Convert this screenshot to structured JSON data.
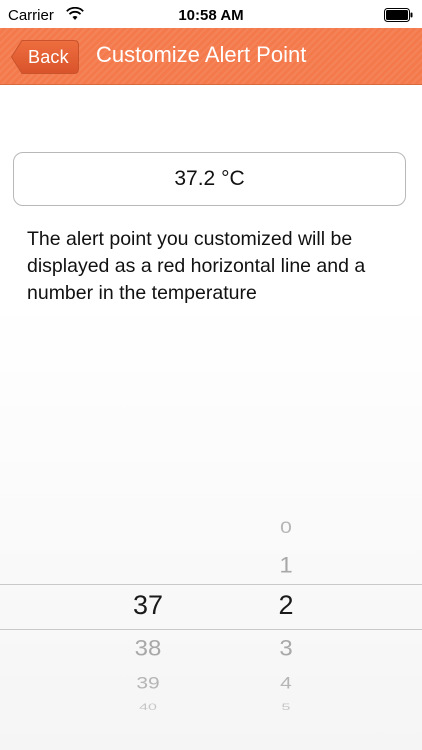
{
  "status_bar": {
    "carrier": "Carrier",
    "time": "10:58 AM"
  },
  "nav": {
    "back_label": "Back",
    "title": "Customize Alert Point",
    "color": "#f47a4c"
  },
  "alert": {
    "value": "37.2 °C",
    "description": "The alert point you customized will be displayed as a red horizontal line and a number in the temperature"
  },
  "picker": {
    "whole_column": [
      "37",
      "38",
      "39",
      "40"
    ],
    "decimal_column": [
      "0",
      "1",
      "2",
      "3",
      "4",
      "5"
    ],
    "selected_whole": "37",
    "selected_decimal": "2"
  }
}
